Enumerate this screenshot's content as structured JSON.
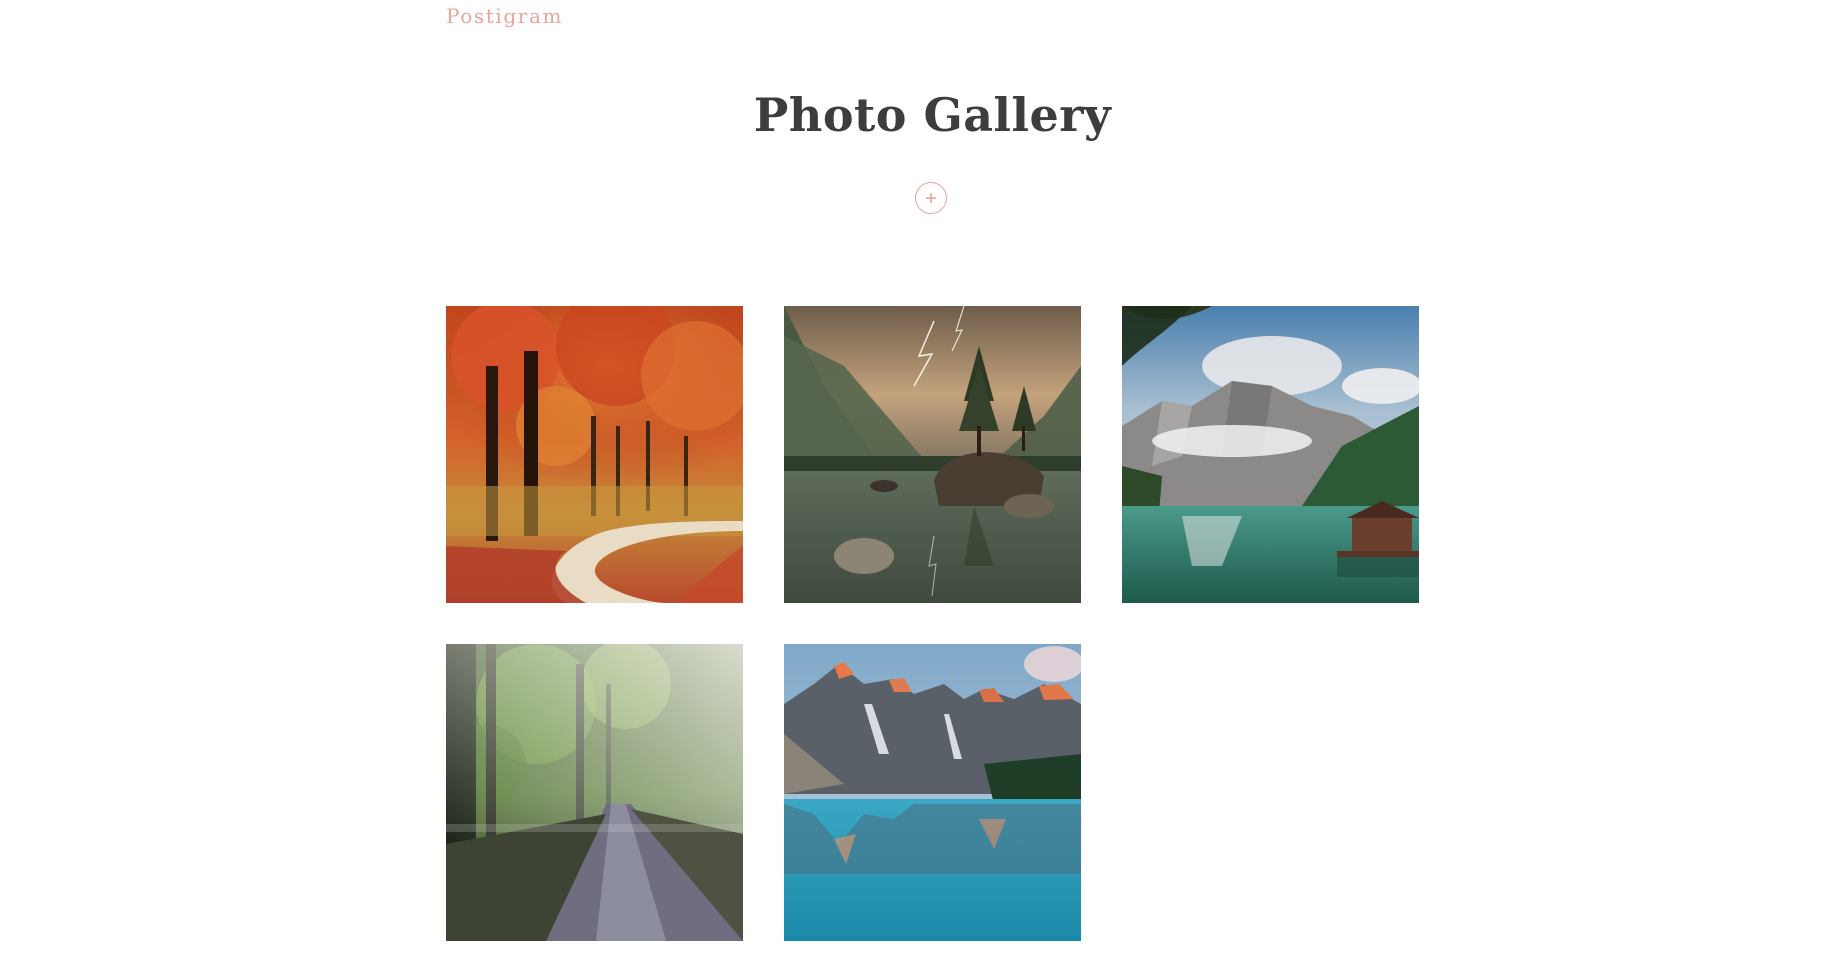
{
  "brand": {
    "name": "Postigram",
    "color": "#e8a59c"
  },
  "header": {
    "title": "Photo Gallery",
    "title_color": "#3d3d3d"
  },
  "add_button": {
    "icon": "plus-icon",
    "color": "#e8a59c"
  },
  "gallery": {
    "photos": [
      {
        "subject": "autumn-forest-path",
        "icon": "photo-autumn-forest"
      },
      {
        "subject": "lake-island-lightning",
        "icon": "photo-lightning-lake"
      },
      {
        "subject": "mountain-lake-cabin",
        "icon": "photo-mountain-cabin"
      },
      {
        "subject": "sunlit-forest-road",
        "icon": "photo-forest-road"
      },
      {
        "subject": "turquoise-mountain-lake",
        "icon": "photo-turquoise-lake"
      }
    ]
  }
}
